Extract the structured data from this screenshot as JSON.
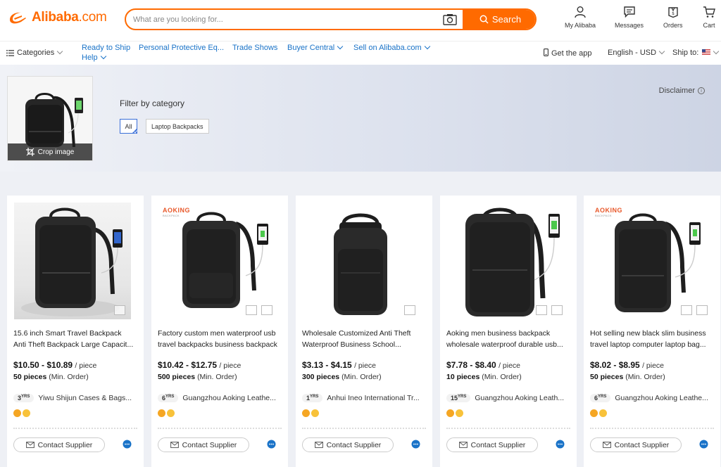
{
  "header": {
    "logo_text": "Alibaba",
    "logo_suffix": ".com",
    "search_placeholder": "What are you looking for...",
    "search_label": "Search",
    "nav": [
      "My Alibaba",
      "Messages",
      "Orders",
      "Cart"
    ]
  },
  "subbar": {
    "categories": "Categories",
    "links": [
      "Ready to Ship",
      "Personal Protective Eq...",
      "Trade Shows",
      "Buyer Central",
      "Sell on Alibaba.com"
    ],
    "help": "Help",
    "get_app": "Get the app",
    "language": "English - USD",
    "ship_to": "Ship to:"
  },
  "banner": {
    "crop_label": "Crop image",
    "filter_title": "Filter by category",
    "chips": [
      "All",
      "Laptop Backpacks"
    ],
    "disclaimer": "Disclaimer"
  },
  "products": [
    {
      "title1": "15.6 inch Smart Travel Backpack",
      "title2": "Anti Theft Backpack Large Capacit...",
      "price": "$10.50 - $10.89",
      "unit": "/ piece",
      "moq": "50 pieces",
      "moq_suffix": "(Min. Order)",
      "yrs": "3",
      "supplier": "Yiwu Shijun Cases & Bags...",
      "contact": "Contact Supplier"
    },
    {
      "title1": "Factory custom men waterproof usb",
      "title2": "travel backpacks business backpack",
      "price": "$10.42 - $12.75",
      "unit": "/ piece",
      "moq": "500 pieces",
      "moq_suffix": "(Min. Order)",
      "yrs": "6",
      "supplier": "Guangzhou Aoking Leathe...",
      "contact": "Contact Supplier",
      "brand": "AOKING"
    },
    {
      "title1": "Wholesale Customized Anti Theft",
      "title2": "Waterproof Business School...",
      "price": "$3.13 - $4.15",
      "unit": "/ piece",
      "moq": "300 pieces",
      "moq_suffix": "(Min. Order)",
      "yrs": "1",
      "supplier": "Anhui Ineo International Tr...",
      "contact": "Contact Supplier"
    },
    {
      "title1": "Aoking men business backpack",
      "title2": "wholesale waterproof durable usb...",
      "price": "$7.78 - $8.40",
      "unit": "/ piece",
      "moq": "10 pieces",
      "moq_suffix": "(Min. Order)",
      "yrs": "15",
      "supplier": "Guangzhou Aoking Leath...",
      "contact": "Contact Supplier"
    },
    {
      "title1": "Hot selling new black slim business",
      "title2": "travel laptop computer laptop bag...",
      "price": "$8.02 - $8.95",
      "unit": "/ piece",
      "moq": "50 pieces",
      "moq_suffix": "(Min. Order)",
      "yrs": "6",
      "supplier": "Guangzhou Aoking Leathe...",
      "contact": "Contact Supplier",
      "brand": "AOKING"
    }
  ],
  "brand_sub": "BACKPACK",
  "yrs_suffix": "YRS",
  "colors": {
    "accent": "#ff6a00",
    "link": "#1a73c8"
  }
}
